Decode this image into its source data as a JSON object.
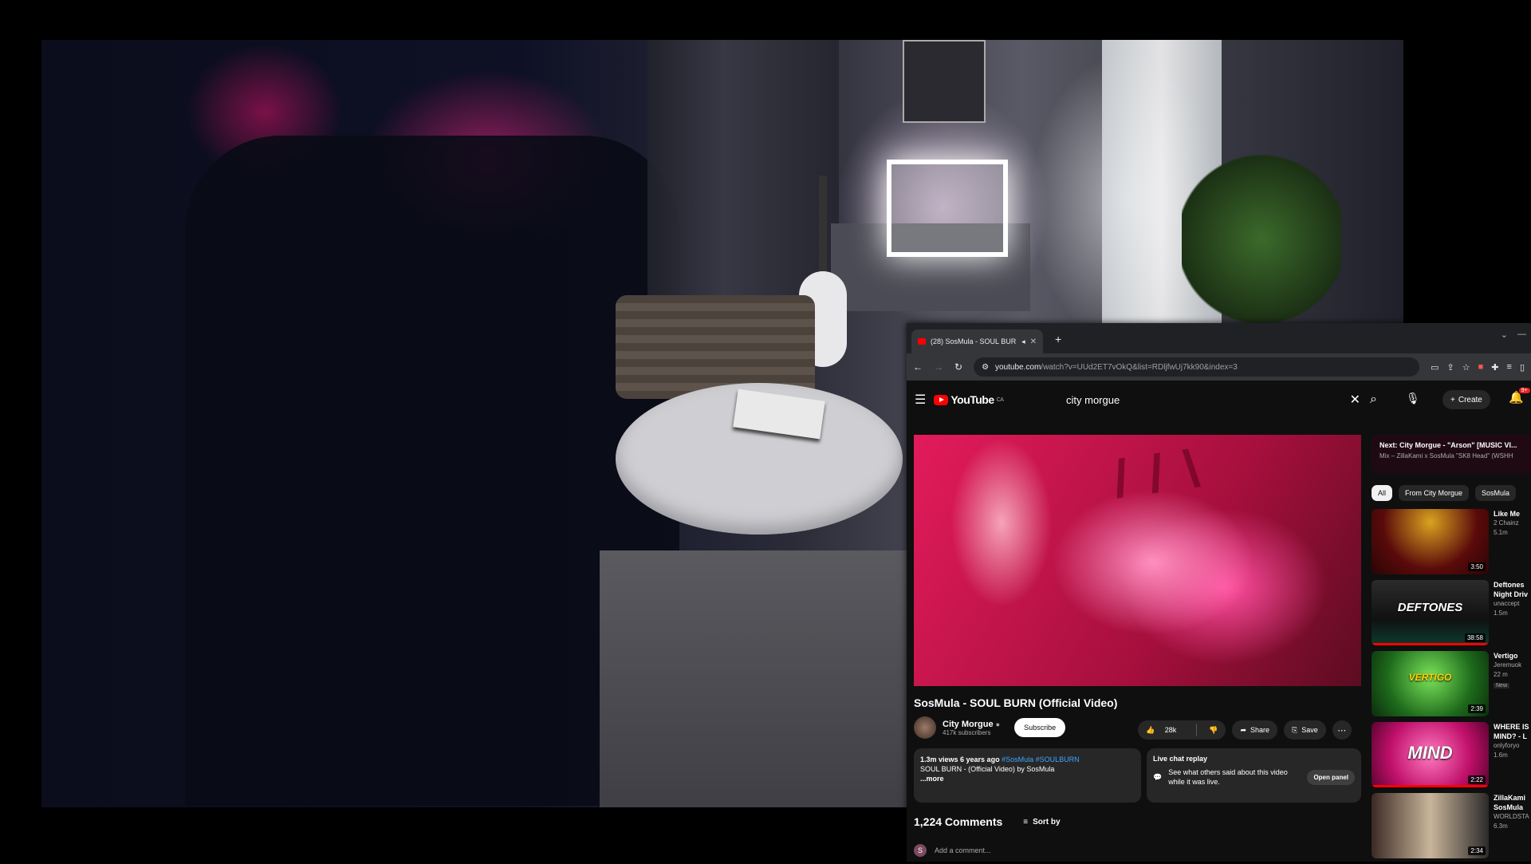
{
  "browser": {
    "tab_title": "(28) SosMula - SOUL BURN",
    "url_host": "youtube.com",
    "url_path": "/watch?v=UUd2ET7vOkQ&list=RDljfwUj7kk90&index=3"
  },
  "youtube": {
    "logo_text": "YouTube",
    "logo_region": "CA",
    "search_query": "city morgue",
    "create_label": "Create",
    "notifications_badge": "9+"
  },
  "video": {
    "title": "SosMula - SOUL BURN (Official Video)",
    "channel": "City Morgue",
    "subscribers": "417k subscribers",
    "subscribe_label": "Subscribe",
    "likes": "28k",
    "share_label": "Share",
    "save_label": "Save",
    "description_meta": "1.3m views  6 years ago",
    "description_tags": "#SosMula #SOULBURN",
    "description_text": "SOUL BURN - (Official Video) by SosMula",
    "description_more": "...more"
  },
  "live_chat": {
    "title": "Live chat replay",
    "text": "See what others said about this video while it was live.",
    "button": "Open panel"
  },
  "comments": {
    "count": "1,224 Comments",
    "sort_label": "Sort by",
    "avatar_letter": "S",
    "placeholder": "Add a comment..."
  },
  "sidebar": {
    "up_next": "Next: City Morgue - \"Arson\" [MUSIC VI...",
    "up_next_sub": "Mix – ZillaKami x SosMula \"SK8 Head\" (WSHH",
    "chips": [
      "All",
      "From City Morgue",
      "SosMula"
    ],
    "recommendations": [
      {
        "title": "Like Me",
        "channel": "2 Chainz",
        "meta": "5.1m",
        "duration": "3:50"
      },
      {
        "title": "Deftones",
        "title2": "Night Driv",
        "channel": "unaccept",
        "meta": "1.5m",
        "duration": "38:58",
        "thumb_text": "DEFTONES"
      },
      {
        "title": "Vertigo",
        "channel": "Jeremuok",
        "meta": "22 m",
        "badge": "New",
        "duration": "2:39",
        "thumb_text": "VERTIGO"
      },
      {
        "title": "WHERE IS",
        "title2": "MIND? - L",
        "channel": "onlyforyo",
        "meta": "1.6m",
        "duration": "2:22",
        "thumb_text": "MIND"
      },
      {
        "title": "ZillaKami",
        "title2": "SosMula",
        "channel": "WORLDSTA",
        "meta": "6.3m",
        "duration": "2:34"
      }
    ]
  },
  "colors": {
    "yt_background": "#0f0f0f",
    "yt_red": "#ff0000",
    "chip_active": "#f1f1f1",
    "link_blue": "#3ea6ff"
  }
}
